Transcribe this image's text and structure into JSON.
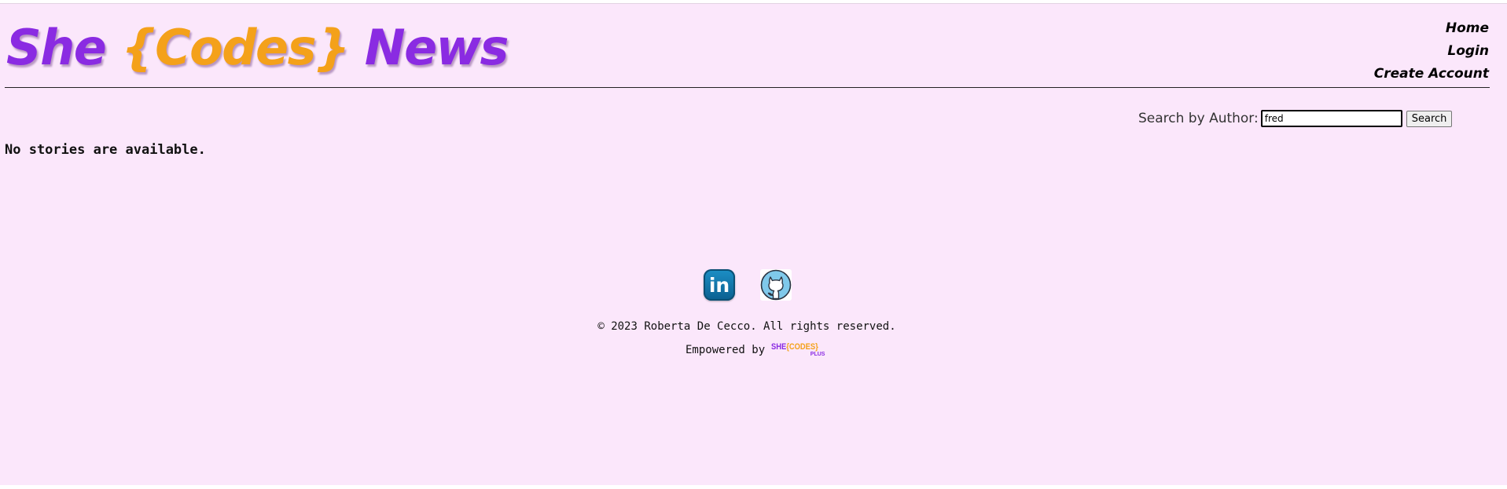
{
  "header": {
    "title_parts": [
      "She ",
      "{Codes}",
      " News"
    ],
    "title_colors": {
      "primary": "#8a2be2",
      "accent": "#f4a11a"
    },
    "nav": [
      "Home",
      "Login",
      "Create Account"
    ]
  },
  "search": {
    "label": "Search by Author:",
    "value": "fred",
    "button_label": "Search"
  },
  "main": {
    "empty_message": "No stories are available."
  },
  "footer": {
    "social_icons": [
      "linkedin-icon",
      "github-icon"
    ],
    "linkedin_text": "in",
    "copyright": "© 2023 Roberta De Cecco. All rights reserved.",
    "empowered_by": "Empowered by",
    "logo": {
      "main_parts": [
        "SHE",
        "{CODES}"
      ],
      "sub": "PLUS"
    }
  },
  "colors": {
    "background": "#fbe7fb"
  }
}
